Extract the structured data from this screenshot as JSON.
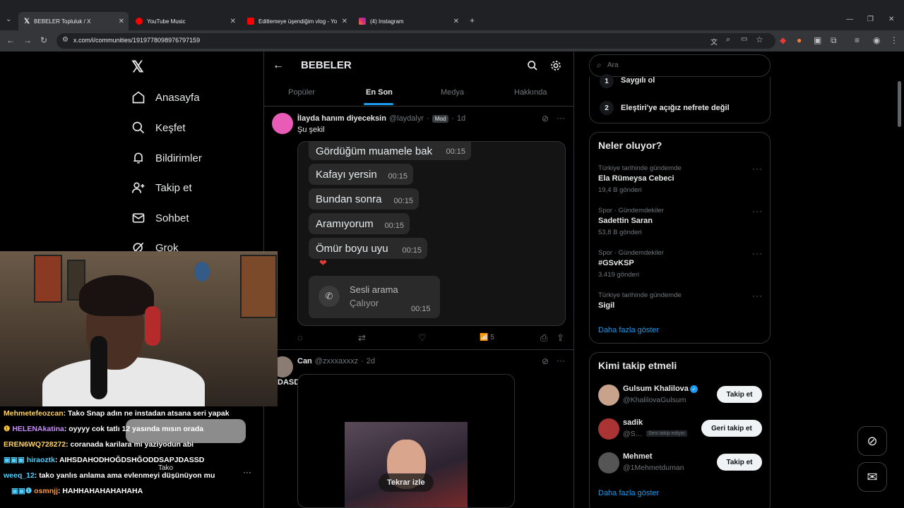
{
  "browser": {
    "tabs": [
      {
        "label": "BEBELER Topluluk / X",
        "favicon": "x-icon"
      },
      {
        "label": "YouTube Music",
        "favicon": "youtube-music-icon"
      },
      {
        "label": "Editlemeye üşendiğim vlog - Yo",
        "favicon": "youtube-icon"
      },
      {
        "label": "(4) Instagram",
        "favicon": "instagram-icon"
      }
    ],
    "url": "x.com/i/communities/1919778098976797159"
  },
  "left_nav": {
    "items": [
      {
        "label": "Anasayfa",
        "icon": "home-icon"
      },
      {
        "label": "Keşfet",
        "icon": "search-icon"
      },
      {
        "label": "Bildirimler",
        "icon": "bell-icon"
      },
      {
        "label": "Takip et",
        "icon": "person-add-icon"
      },
      {
        "label": "Sohbet",
        "icon": "mail-icon"
      },
      {
        "label": "Grok",
        "icon": "grok-icon"
      }
    ]
  },
  "community": {
    "title": "BEBELER",
    "tabs": [
      "Popüler",
      "En Son",
      "Medya",
      "Hakkında"
    ],
    "active_tab": "En Son"
  },
  "post1": {
    "name": "İlayda hanım diyeceksin",
    "handle": "@laydalyr",
    "badge": "Mod",
    "time": "1d",
    "text": "Şu şekil",
    "messages": [
      {
        "text": "Gördüğüm muamele bak",
        "time": "00:15"
      },
      {
        "text": "Kafayı yersin",
        "time": "00:15"
      },
      {
        "text": "Bundan sonra",
        "time": "00:15"
      },
      {
        "text": "Aramıyorum",
        "time": "00:15"
      },
      {
        "text": "Ömür boyu uyu",
        "time": "00:15"
      }
    ],
    "call_title": "Sesli arama",
    "call_status": "Çalıyor",
    "call_time": "00:15",
    "views": "5"
  },
  "post2": {
    "name": "Can",
    "handle": "@zxxxaxxxz",
    "time": "2d",
    "text": "DASD",
    "replay_label": "Tekrar izle"
  },
  "right": {
    "search_placeholder": "Ara",
    "rules": [
      {
        "num": "1",
        "text": "Saygılı ol"
      },
      {
        "num": "2",
        "text": "Eleştiri'ye açığız nefrete değil"
      }
    ],
    "trends_title": "Neler oluyor?",
    "trends": [
      {
        "context": "Türkiye tarihinde gündemde",
        "name": "Ela Rümeysa Cebeci",
        "count": "19,4 B gönderi"
      },
      {
        "context": "Spor · Gündemdekiler",
        "name": "Sadettin Saran",
        "count": "53,8 B gönderi"
      },
      {
        "context": "Spor · Gündemdekiler",
        "name": "#GSvKSP",
        "count": "3.419 gönderi"
      },
      {
        "context": "Türkiye tarihinde gündemde",
        "name": "Sigil",
        "count": ""
      }
    ],
    "show_more": "Daha fazla göster",
    "follow_title": "Kimi takip etmeli",
    "follow": [
      {
        "name": "Gulsum Khalilova",
        "handle": "@KhalilovaGulsum",
        "button": "Takip et",
        "verified": true
      },
      {
        "name": "sadik",
        "handle": "@S...",
        "follows_you": "Seni takip ediyor",
        "button": "Geri takip et"
      },
      {
        "name": "Mehmet",
        "handle": "@1Mehmetduman",
        "button": "Takip et"
      }
    ],
    "show_more2": "Daha fazla göster"
  },
  "stream_chat": [
    {
      "user": "Mehmetefeozcan",
      "msg": ": Tako Snap adın ne instadan atsana seri yapak",
      "color": "#ffd36a"
    },
    {
      "user": "HELENAkatina",
      "msg": ": oyyyy cok tatlı 12 yasında mısın orada",
      "color": "#c98cff"
    },
    {
      "user": "EREN6WQ728272",
      "msg": ": coranada karilara mi yaziyodun abi",
      "color": "#ffd36a"
    },
    {
      "user": "hiraoztk",
      "msg": ": AIHSDAHODHOĞDSHĞODDSAPJDASSD",
      "color": "#4fd1ff"
    },
    {
      "user": "weeq_12",
      "msg": ": tako yanlıs anlama ama evlenmeyi düşünüyon mu",
      "color": "#4fd1ff"
    },
    {
      "user": "osmnjj",
      "msg": ": HAHHAHAHAHAHAHA",
      "color": "#ff9a3c"
    }
  ],
  "overlay_name": "Tako"
}
